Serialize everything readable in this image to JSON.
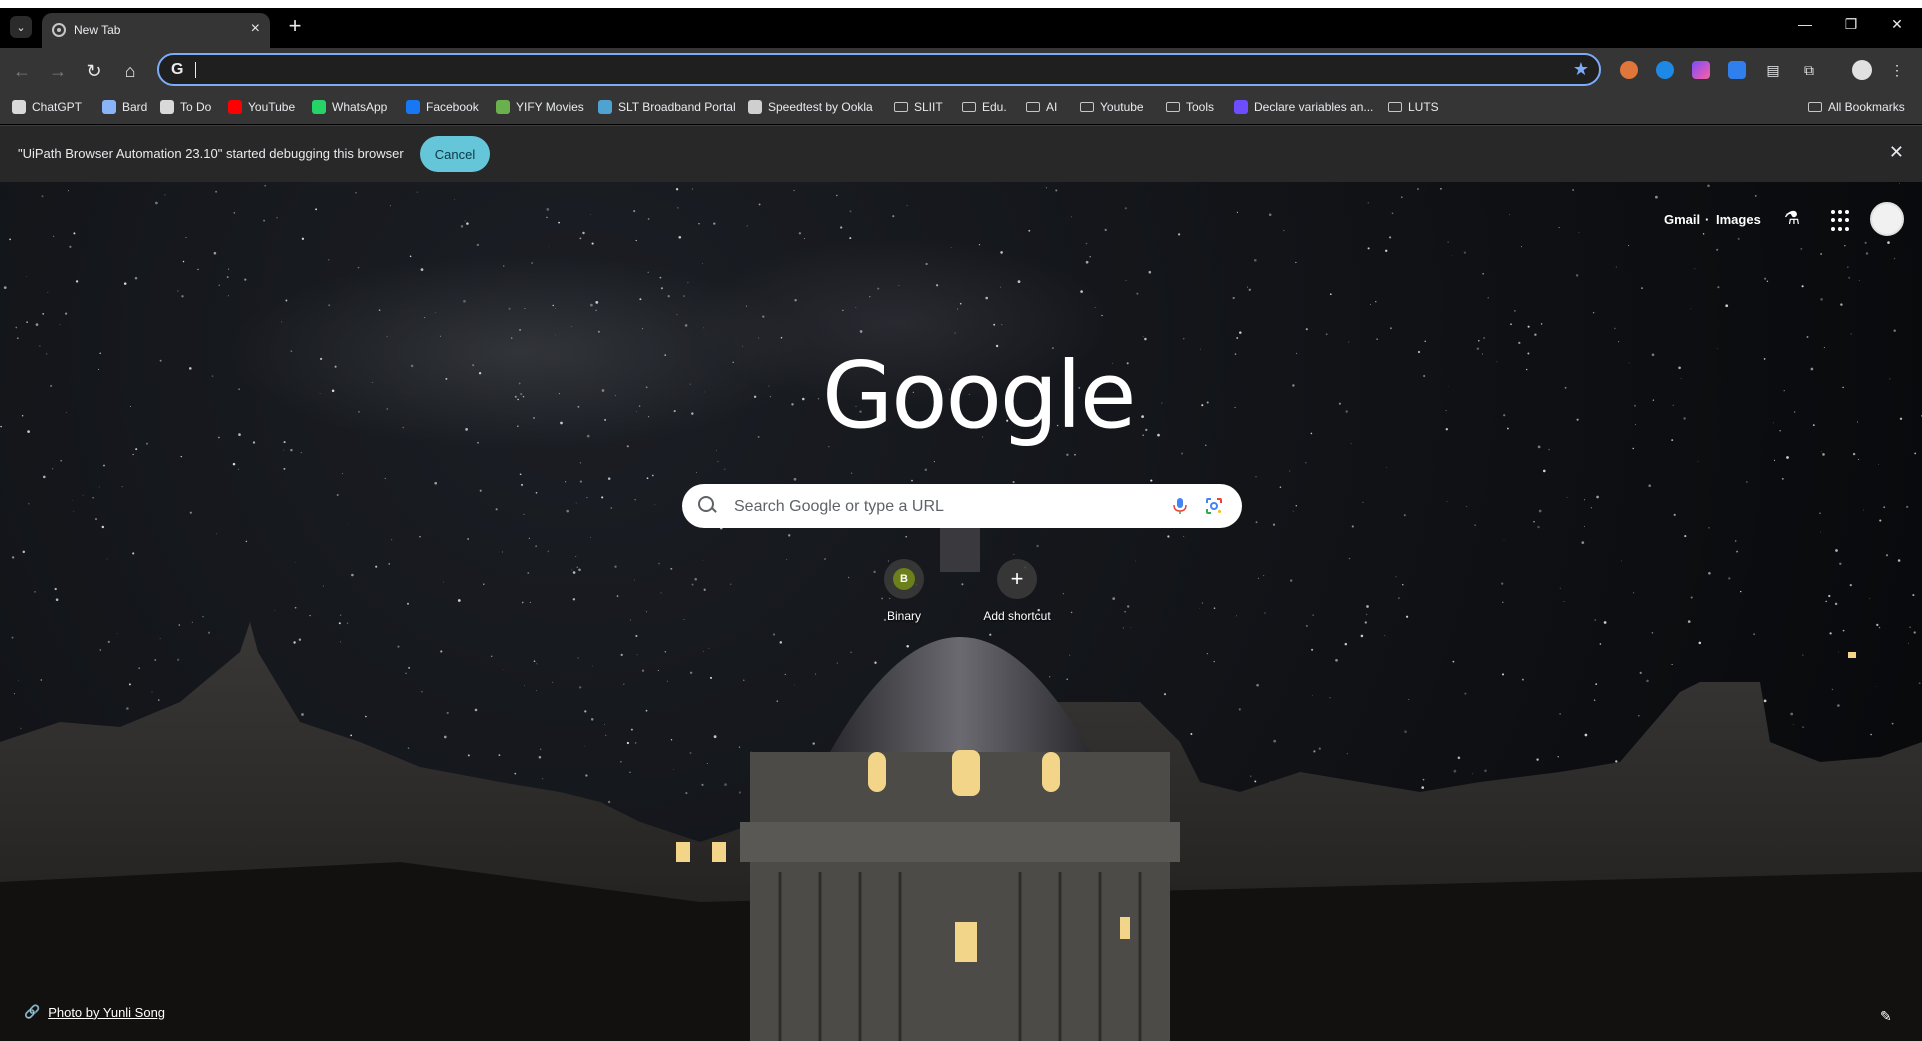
{
  "tab": {
    "title": "New Tab"
  },
  "omnibox": {
    "value": ""
  },
  "bookmarks": [
    {
      "label": "ChatGPT",
      "color": "#d9d9d9"
    },
    {
      "label": "Bard",
      "color": "#8ab4f8"
    },
    {
      "label": "To Do",
      "color": "#d9d9d9"
    },
    {
      "label": "YouTube",
      "color": "#ff0000"
    },
    {
      "label": "WhatsApp",
      "color": "#25d366"
    },
    {
      "label": "Facebook",
      "color": "#1877f2"
    },
    {
      "label": "YIFY Movies",
      "color": "#6ab04c"
    },
    {
      "label": "SLT Broadband Portal",
      "color": "#4fa3d1"
    },
    {
      "label": "Speedtest by Ookla",
      "color": "#cfcfcf"
    },
    {
      "label": "SLIIT",
      "folder": true
    },
    {
      "label": "Edu.",
      "folder": true
    },
    {
      "label": "AI",
      "folder": true
    },
    {
      "label": "Youtube",
      "folder": true
    },
    {
      "label": "Tools",
      "folder": true
    },
    {
      "label": "Declare variables an...",
      "color": "#6e4cff"
    },
    {
      "label": "LUTS",
      "folder": true
    }
  ],
  "all_bookmarks": "All Bookmarks",
  "infobar": {
    "message": "\"UiPath Browser Automation 23.10\" started debugging this browser",
    "cancel": "Cancel"
  },
  "ntp": {
    "gmail": "Gmail",
    "images": "Images",
    "logo": "Google",
    "search_placeholder": "Search Google or type a URL",
    "shortcuts": [
      {
        "label": "Binary",
        "letter": "B"
      },
      {
        "label": "Add shortcut"
      }
    ],
    "attribution": "Photo by Yunli Song"
  },
  "colors": {
    "accent": "#7cacf8",
    "cancel_button": "#65c6d9"
  }
}
